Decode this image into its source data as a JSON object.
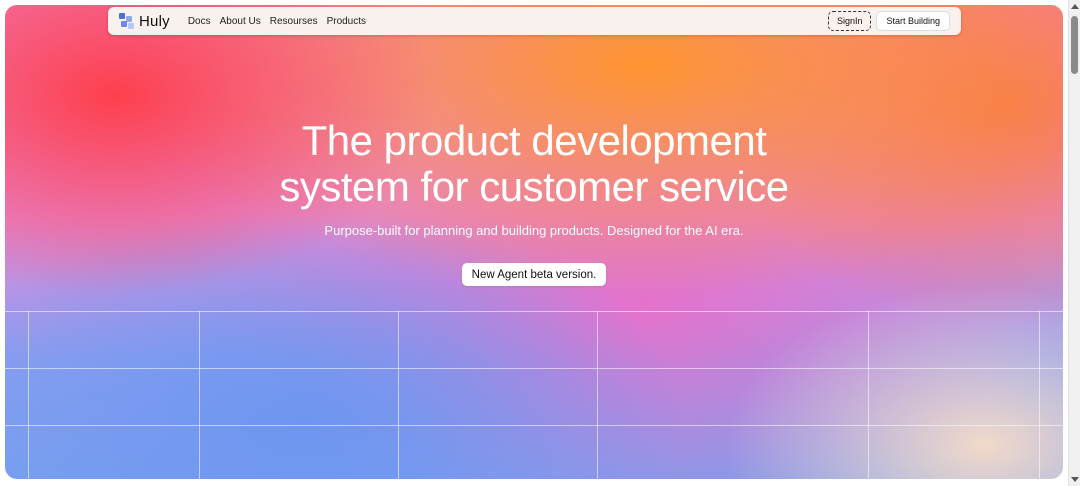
{
  "nav": {
    "brand": "Huly",
    "links": [
      "Docs",
      "About Us",
      "Resourses",
      "Products"
    ],
    "signin_label": "SignIn",
    "start_label": "Start Building"
  },
  "hero": {
    "headline_line1": "The product development",
    "headline_line2": "system for customer service",
    "subheadline": "Purpose-built for planning and building products. Designed for the AI era.",
    "cta_label": "New Agent beta version."
  },
  "colors": {
    "red": "#ff3c46",
    "orange": "#ff9628",
    "pink": "#eb6ec8",
    "blue": "#6e96f0",
    "peach": "#f8dcc8"
  },
  "icons": {
    "logo": "huly-logo-icon",
    "scroll_up": "scroll-up-arrow-icon",
    "scroll_down": "scroll-down-arrow-icon"
  }
}
